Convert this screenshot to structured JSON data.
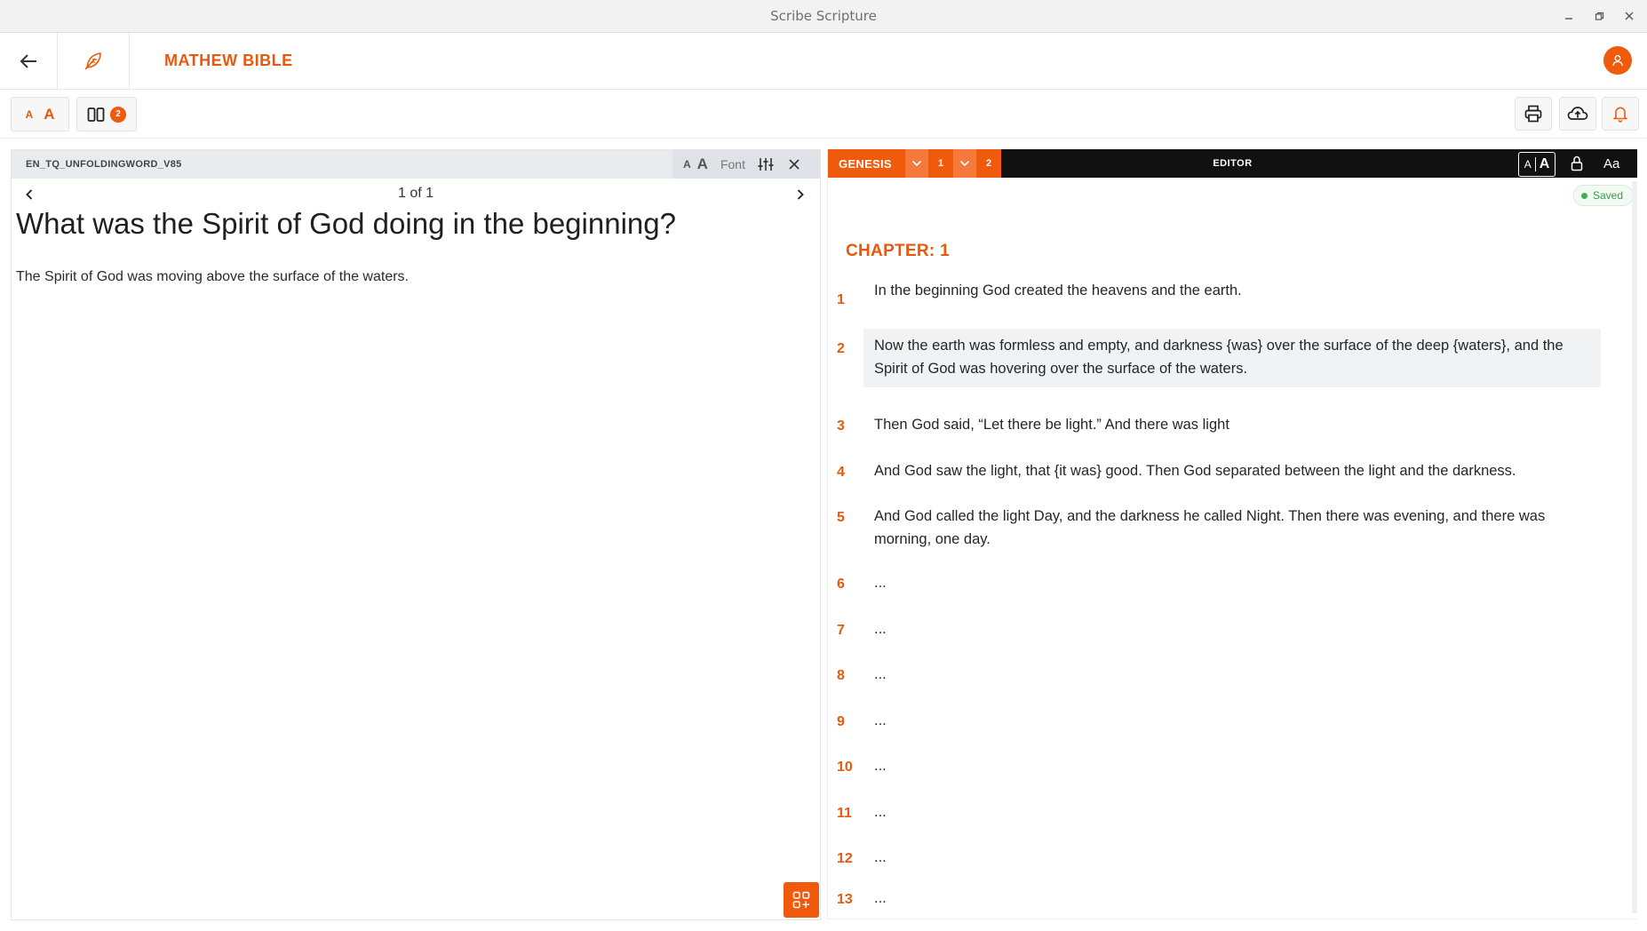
{
  "window": {
    "title": "Scribe Scripture",
    "controls": [
      "minimize-icon",
      "restore-icon",
      "close-icon"
    ]
  },
  "header": {
    "project_title": "MATHEW BIBLE",
    "icons": [
      "back-arrow-icon",
      "feather-pen-icon",
      "user-icon"
    ]
  },
  "toolbar": {
    "font_small": "A",
    "font_large": "A",
    "pane_count": "2",
    "right_icons": [
      "printer-icon",
      "cloud-upload-icon",
      "bell-icon"
    ]
  },
  "resource_pane": {
    "resource_name": "EN_TQ_UNFOLDINGWORD_V85",
    "font_small": "A",
    "font_large": "A",
    "font_label": "Font",
    "pagination": "1 of 1",
    "question": "What was the Spirit of God doing in the beginning?",
    "answer": "The Spirit of God was moving above the surface of the waters."
  },
  "editor": {
    "book": "GENESIS",
    "chapter_num": "1",
    "verse_num": "2",
    "title": "EDITOR",
    "aa_small": "A",
    "aa_large": "A",
    "aa_label": "Aa",
    "saved_label": "Saved",
    "chapter_heading": "CHAPTER: 1",
    "active_verse": "2",
    "verses": [
      {
        "num": "1",
        "text": "In the beginning God created the heavens and the earth."
      },
      {
        "num": "2",
        "text": "Now the earth was formless and empty, and darkness {was} over the surface of the deep {waters}, and the Spirit of God was hovering over the surface of the waters."
      },
      {
        "num": "3",
        "text": "Then God said, “Let there be light.” And there was light"
      },
      {
        "num": "4",
        "text": "And God saw the light, that {it was} good. Then God separated between the light and the darkness."
      },
      {
        "num": "5",
        "text": "And God called the light Day, and the darkness he called Night. Then there was evening, and there was morning, one day."
      },
      {
        "num": "6",
        "text": "..."
      },
      {
        "num": "7",
        "text": "..."
      },
      {
        "num": "8",
        "text": "..."
      },
      {
        "num": "9",
        "text": "..."
      },
      {
        "num": "10",
        "text": "..."
      },
      {
        "num": "11",
        "text": "..."
      },
      {
        "num": "12",
        "text": "..."
      },
      {
        "num": "13",
        "text": "..."
      }
    ]
  },
  "colors": {
    "accent": "#f05a0d",
    "accent_text": "#e8590c",
    "editor_bar": "#111111",
    "saved_green": "#3a9a48"
  }
}
